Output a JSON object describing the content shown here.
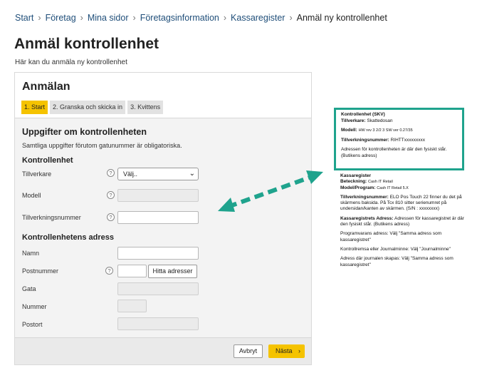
{
  "breadcrumb": {
    "items": [
      "Start",
      "Företag",
      "Mina sidor",
      "Företagsinformation",
      "Kassaregister"
    ],
    "current": "Anmäl ny kontrollenhet"
  },
  "page": {
    "title": "Anmäl kontrollenhet",
    "intro": "Här kan du anmäla ny kontrollenhet"
  },
  "panel": {
    "heading": "Anmälan",
    "steps": [
      "1. Start",
      "2. Granska och skicka in",
      "3. Kvittens"
    ],
    "active_step": 0,
    "section_title": "Uppgifter om kontrollenheten",
    "section_note": "Samtliga uppgifter förutom gatunummer är obligatoriska.",
    "group1_title": "Kontrollenhet",
    "group2_title": "Kontrollenhetens adress",
    "fields": {
      "tillverkare": {
        "label": "Tillverkare",
        "value": "Välj.."
      },
      "modell": {
        "label": "Modell",
        "value": ""
      },
      "tillverkningsnummer": {
        "label": "Tillverkningsnummer",
        "value": ""
      },
      "namn": {
        "label": "Namn",
        "value": ""
      },
      "postnummer": {
        "label": "Postnummer",
        "value": ""
      },
      "gata": {
        "label": "Gata",
        "value": ""
      },
      "nummer": {
        "label": "Nummer",
        "value": ""
      },
      "postort": {
        "label": "Postort",
        "value": ""
      }
    },
    "help_glyph": "?",
    "find_button": "Hitta adresser",
    "cancel_button": "Avbryt",
    "next_button": "Nästa",
    "next_arrow": "›",
    "select_chevron": "⌄"
  },
  "callout": {
    "title": "Kontrollenhet (SKV)",
    "tillverkare_label": "Tillverkare:",
    "tillverkare_value": "Skattedosan",
    "modell_label": "Modell:",
    "modell_value": "HW rev 3 2/2 3 SW ver 0.27/35",
    "tillverkningsnummer_label": "Tillverkningsnummer:",
    "tillverkningsnummer_value": "RIHTTxxxxxxxxx",
    "address_note": "Adressen för kontrollenheten är där den fysiskt står. (Butikens adress)"
  },
  "notes": {
    "kassaregister_title": "Kassaregister",
    "beteckning_label": "Beteckning:",
    "beteckning_value": "Cash IT Retail",
    "modell_program_label": "Model/Program:",
    "modell_program_value": "Cash IT Retail 5.X",
    "tillverkningsnummer_label": "Tillverkningsnummer:",
    "tillverkningsnummer_value": "ELO Pos Touch 22 finner du det på skärmens baksida. På Tcx 810 sitter serienumret på undersidan/kanten av skärmen. (S/N : xxxxxxxx)",
    "adress_label": "Kassaregistrets Adress:",
    "adress_value": "Adressen för kassaregistret är där den fysiskt står. (Butikens adress)",
    "programvara": "Programvarans adress: Välj \"Samma adress som kassaregistret\"",
    "kontrollremsa": "Kontrollremsa eller Journalminne: Välj \"Journalminne\"",
    "journal": "Adress där journalen skapas: Välj \"Samma adress som kassaregistret\""
  },
  "colors": {
    "accent_yellow": "#f5c300",
    "callout_border": "#1fa38d",
    "link": "#1f4e79"
  }
}
